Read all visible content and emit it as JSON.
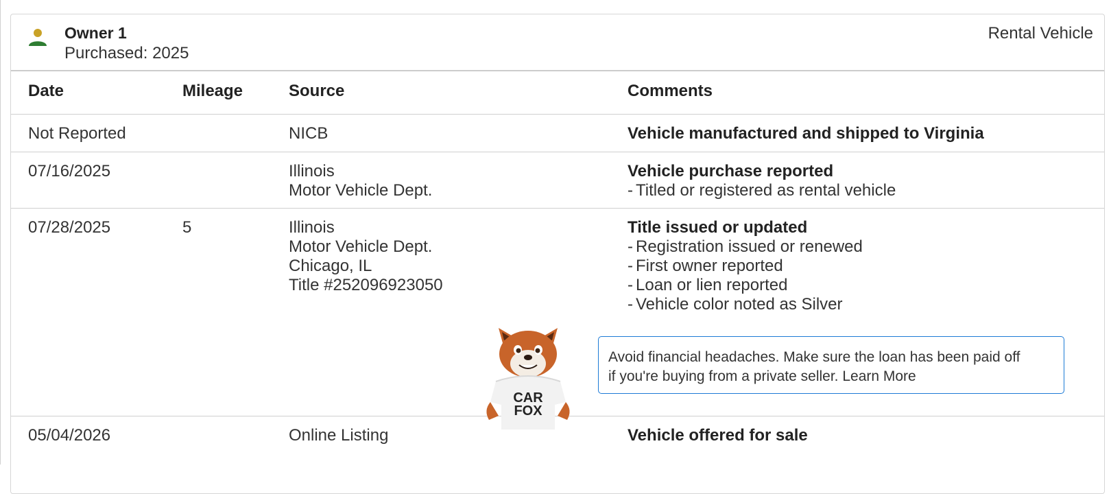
{
  "owner": {
    "title": "Owner 1",
    "purchased": "Purchased: 2025",
    "type": "Rental Vehicle",
    "icon": "person-icon"
  },
  "columns": {
    "date": "Date",
    "mileage": "Mileage",
    "source": "Source",
    "comments": "Comments"
  },
  "rows": [
    {
      "date": "Not Reported",
      "mileage": "",
      "source": [
        "NICB"
      ],
      "comment_title": "Vehicle manufactured and shipped to Virginia",
      "details": []
    },
    {
      "date": "07/16/2025",
      "mileage": "",
      "source": [
        "Illinois",
        "Motor Vehicle Dept."
      ],
      "comment_title": "Vehicle purchase reported",
      "details": [
        "Titled or registered as rental vehicle"
      ]
    },
    {
      "date": "07/28/2025",
      "mileage": "5",
      "source": [
        "Illinois",
        "Motor Vehicle Dept.",
        "Chicago, IL",
        "Title #252096923050"
      ],
      "comment_title": "Title issued or updated",
      "details": [
        "Registration issued or renewed",
        "First owner reported",
        "Loan or lien reported",
        "Vehicle color noted as Silver"
      ]
    },
    {
      "date": "05/04/2026",
      "mileage": "",
      "source": [
        "Online Listing"
      ],
      "comment_title": "Vehicle offered for sale",
      "details": []
    }
  ],
  "tip": {
    "line1": "Avoid financial headaches. Make sure the loan has been paid off",
    "line2": "if you're buying from a private seller. Learn More"
  },
  "mascot": {
    "shirt_line1": "CAR",
    "shirt_line2": "FOX"
  },
  "colors": {
    "accent_blue": "#1c7ad6",
    "icon_gold": "#c9a227",
    "icon_green": "#2e7d32",
    "fox_orange": "#c8642a"
  }
}
